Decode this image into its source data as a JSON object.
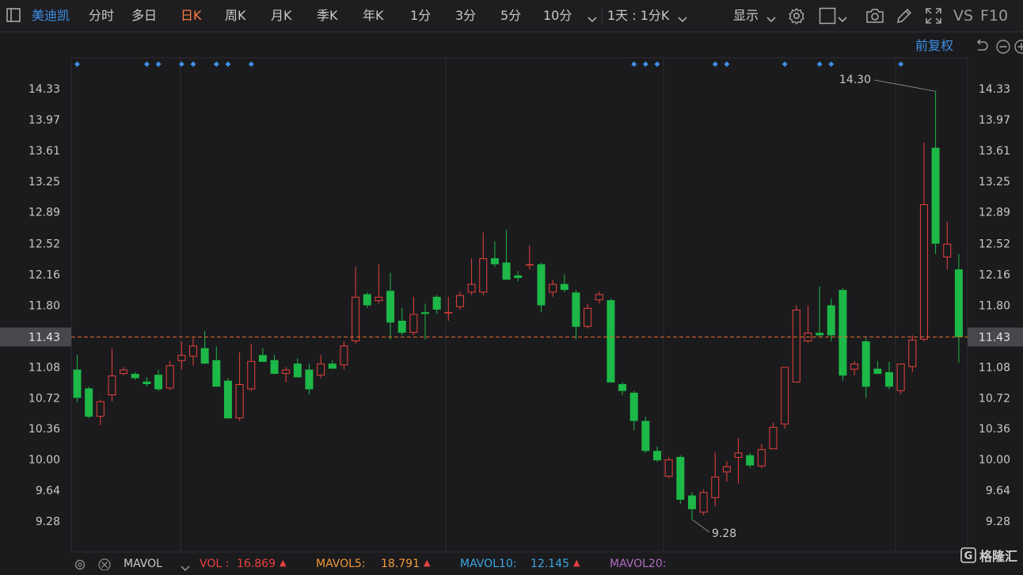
{
  "toolbar": {
    "stock_name": "美迪凯",
    "periods": [
      "分时",
      "多日",
      "日K",
      "周K",
      "月K",
      "季K",
      "年K",
      "1分",
      "3分",
      "5分",
      "10分"
    ],
    "active_period": "日K",
    "interval_label": "1天 : 1分K",
    "display_label": "显示",
    "vs_label": "VS",
    "f10_label": "F10"
  },
  "subbar": {
    "adjust_label": "前复权"
  },
  "chart_data": {
    "type": "candlestick",
    "ylim": [
      9.1,
      14.55
    ],
    "y_ticks": [
      "14.33",
      "13.97",
      "13.61",
      "13.25",
      "12.89",
      "12.52",
      "12.16",
      "11.80",
      "11.43",
      "11.08",
      "10.72",
      "10.36",
      "10.00",
      "9.64",
      "9.28"
    ],
    "current_price": "11.43",
    "max_label": "14.30",
    "min_label": "9.28",
    "colors": {
      "up": "#e8413e",
      "down": "#1db848",
      "current_line": "#e36a2c"
    },
    "candles": [
      [
        11.05,
        11.22,
        10.67,
        10.72
      ],
      [
        10.83,
        10.85,
        10.48,
        10.5
      ],
      [
        10.5,
        10.7,
        10.4,
        10.68
      ],
      [
        10.75,
        11.3,
        10.68,
        10.98
      ],
      [
        11.0,
        11.08,
        10.98,
        11.05
      ],
      [
        11.0,
        11.02,
        10.93,
        10.95
      ],
      [
        10.91,
        10.96,
        10.85,
        10.88
      ],
      [
        10.99,
        11.05,
        10.8,
        10.82
      ],
      [
        10.83,
        11.15,
        10.81,
        11.1
      ],
      [
        11.15,
        11.38,
        11.05,
        11.22
      ],
      [
        11.2,
        11.42,
        11.1,
        11.33
      ],
      [
        11.3,
        11.5,
        11.16,
        11.12
      ],
      [
        11.16,
        11.32,
        10.88,
        10.85
      ],
      [
        10.92,
        10.95,
        10.48,
        10.48
      ],
      [
        10.48,
        11.25,
        10.45,
        10.88
      ],
      [
        10.82,
        11.35,
        10.8,
        11.15
      ],
      [
        11.22,
        11.3,
        11.14,
        11.14
      ],
      [
        11.16,
        11.22,
        11.0,
        11.0
      ],
      [
        11.0,
        11.08,
        10.9,
        11.05
      ],
      [
        11.12,
        11.18,
        10.96,
        10.96
      ],
      [
        11.05,
        11.12,
        10.76,
        10.82
      ],
      [
        10.98,
        11.22,
        10.95,
        11.12
      ],
      [
        11.12,
        11.16,
        11.06,
        11.06
      ],
      [
        11.1,
        11.38,
        11.05,
        11.33
      ],
      [
        11.38,
        12.25,
        11.35,
        11.9
      ],
      [
        11.93,
        11.95,
        11.77,
        11.8
      ],
      [
        11.85,
        12.28,
        11.82,
        11.9
      ],
      [
        11.97,
        12.18,
        11.4,
        11.6
      ],
      [
        11.62,
        11.77,
        11.45,
        11.48
      ],
      [
        11.48,
        11.9,
        11.45,
        11.7
      ],
      [
        11.72,
        11.82,
        11.4,
        11.7
      ],
      [
        11.9,
        11.92,
        11.7,
        11.75
      ],
      [
        11.72,
        11.9,
        11.62,
        11.72
      ],
      [
        11.78,
        11.96,
        11.75,
        11.92
      ],
      [
        11.95,
        12.35,
        11.92,
        12.05
      ],
      [
        11.95,
        12.65,
        11.92,
        12.35
      ],
      [
        12.35,
        12.55,
        12.25,
        12.28
      ],
      [
        12.3,
        12.68,
        12.12,
        12.1
      ],
      [
        12.15,
        12.2,
        12.08,
        12.12
      ],
      [
        12.27,
        12.5,
        12.22,
        12.28
      ],
      [
        12.28,
        12.3,
        11.72,
        11.8
      ],
      [
        11.95,
        12.1,
        11.9,
        12.05
      ],
      [
        12.05,
        12.16,
        11.95,
        11.98
      ],
      [
        11.95,
        11.98,
        11.4,
        11.55
      ],
      [
        11.55,
        11.82,
        11.53,
        11.77
      ],
      [
        11.86,
        11.96,
        11.82,
        11.93
      ],
      [
        11.86,
        11.88,
        10.9,
        10.9
      ],
      [
        10.88,
        10.9,
        10.75,
        10.8
      ],
      [
        10.78,
        10.8,
        10.34,
        10.45
      ],
      [
        10.45,
        10.5,
        10.08,
        10.1
      ],
      [
        10.1,
        10.15,
        9.97,
        9.99
      ],
      [
        9.8,
        10.03,
        9.78,
        10.0
      ],
      [
        10.03,
        10.05,
        9.48,
        9.53
      ],
      [
        9.58,
        9.62,
        9.3,
        9.42
      ],
      [
        9.38,
        9.65,
        9.35,
        9.62
      ],
      [
        9.55,
        10.08,
        9.45,
        9.8
      ],
      [
        9.85,
        9.98,
        9.74,
        9.92
      ],
      [
        10.02,
        10.25,
        9.72,
        10.08
      ],
      [
        10.05,
        10.08,
        9.9,
        9.93
      ],
      [
        9.92,
        10.18,
        9.9,
        10.12
      ],
      [
        10.12,
        10.43,
        10.12,
        10.38
      ],
      [
        10.41,
        11.08,
        10.36,
        11.08
      ],
      [
        10.9,
        11.8,
        10.9,
        11.75
      ],
      [
        11.38,
        11.8,
        11.36,
        11.48
      ],
      [
        11.48,
        12.02,
        11.43,
        11.45
      ],
      [
        11.8,
        11.88,
        11.38,
        11.45
      ],
      [
        11.98,
        12.0,
        10.92,
        10.98
      ],
      [
        11.05,
        11.15,
        10.98,
        11.12
      ],
      [
        11.38,
        11.42,
        10.72,
        10.85
      ],
      [
        11.06,
        11.15,
        11.0,
        11.0
      ],
      [
        11.02,
        11.14,
        10.82,
        10.85
      ],
      [
        10.8,
        11.05,
        10.76,
        11.12
      ],
      [
        11.08,
        11.45,
        11.02,
        11.4
      ],
      [
        11.4,
        13.7,
        11.38,
        12.98
      ],
      [
        13.64,
        14.3,
        12.4,
        12.52
      ],
      [
        12.36,
        12.78,
        12.22,
        12.52
      ],
      [
        12.22,
        12.4,
        11.13,
        11.43
      ]
    ],
    "markers": [
      0,
      6,
      7,
      9,
      10,
      12,
      13,
      15,
      48,
      49,
      50,
      55,
      56,
      61,
      64,
      65,
      71
    ]
  },
  "volume_bar": {
    "label_vol": "VOL :",
    "value_vol": "16.869",
    "label_ma5": "MAVOL5:",
    "value_ma5": "18.791",
    "label_ma10": "MAVOL10:",
    "value_ma10": "12.145",
    "label_ma20": "MAVOL20:",
    "mavol_label": "MAVOL",
    "color_vol": "#e8413e",
    "color_ma5": "#f29a38",
    "color_ma10": "#3ba7e6",
    "color_ma20": "#b06ac2"
  },
  "logo_text": "格隆汇"
}
